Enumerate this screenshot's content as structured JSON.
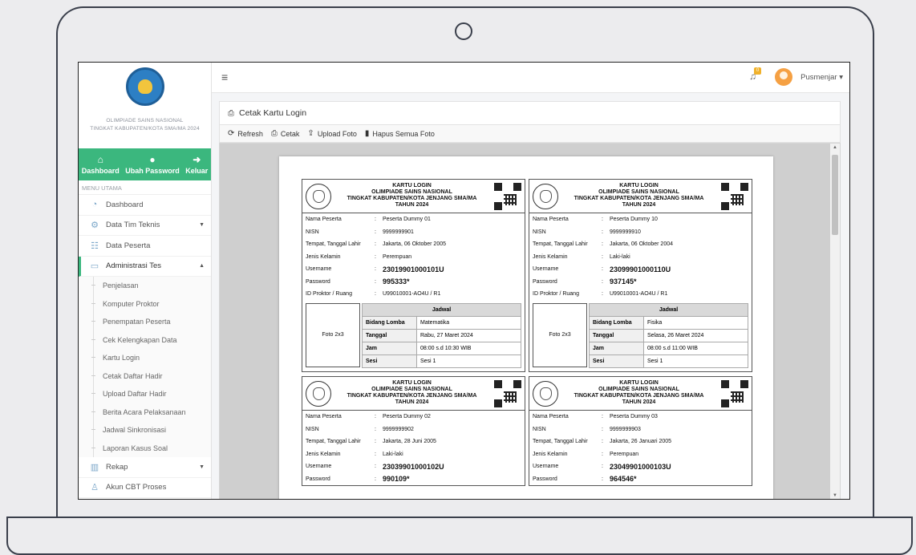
{
  "sidebar": {
    "logo_text_1": "OLIMPIADE SAINS NASIONAL",
    "logo_text_2": "TINGKAT KABUPATEN/KOTA SMA/MA 2024",
    "quick": [
      {
        "label": "Dashboard",
        "icon": "home-icon"
      },
      {
        "label": "Ubah Password",
        "icon": "user-key-icon"
      },
      {
        "label": "Keluar",
        "icon": "logout-icon"
      }
    ],
    "menu_title": "MENU UTAMA",
    "menu": [
      {
        "label": "Dashboard",
        "icon": "dashboard-icon"
      },
      {
        "label": "Data Tim Teknis",
        "icon": "team-icon"
      },
      {
        "label": "Data Peserta",
        "icon": "participants-icon"
      },
      {
        "label": "Administrasi Tes",
        "icon": "monitor-icon"
      }
    ],
    "submenu": [
      "Penjelasan",
      "Komputer Proktor",
      "Penempatan Peserta",
      "Cek Kelengkapan Data",
      "Kartu Login",
      "Cetak Daftar Hadir",
      "Upload Daftar Hadir",
      "Berita Acara Pelaksanaan",
      "Jadwal Sinkronisasi",
      "Laporan Kasus Soal"
    ],
    "menu_after": [
      {
        "label": "Rekap",
        "icon": "chart-icon"
      },
      {
        "label": "Akun CBT Proses",
        "icon": "account-icon"
      }
    ]
  },
  "topbar": {
    "notification_count": "0",
    "user_name": "Pusmenjar"
  },
  "panel": {
    "title": "Cetak Kartu Login",
    "toolbar": {
      "refresh": "Refresh",
      "print": "Cetak",
      "upload": "Upload Foto",
      "delete_all": "Hapus Semua Foto"
    }
  },
  "card_labels": {
    "title_1": "KARTU LOGIN",
    "title_2": "OLIMPIADE SAINS NASIONAL",
    "title_3": "TINGKAT KABUPATEN/KOTA JENJANG SMA/MA",
    "title_4": "TAHUN 2024",
    "nama": "Nama Peserta",
    "nisn": "NISN",
    "ttl": "Tempat, Tanggal Lahir",
    "jk": "Jenis Kelamin",
    "username": "Username",
    "password": "Password",
    "proktor": "ID Proktor / Ruang",
    "sep": ":",
    "foto": "Foto 2x3",
    "jadwal": "Jadwal",
    "bidang": "Bidang Lomba",
    "tanggal": "Tanggal",
    "jam": "Jam",
    "sesi": "Sesi"
  },
  "cards": [
    {
      "nama": "Peserta Dummy 01",
      "nisn": "9999999901",
      "ttl": "Jakarta, 06 Oktober 2005",
      "jk": "Perempuan",
      "username": "23019901000101U",
      "password": "995333*",
      "proktor": "U99010001-AO4U / R1",
      "bidang": "Matematika",
      "tanggal": "Rabu, 27 Maret 2024",
      "jam": "08:00 s.d 10:30 WIB",
      "sesi": "Sesi 1"
    },
    {
      "nama": "Peserta Dummy 10",
      "nisn": "9999999910",
      "ttl": "Jakarta, 06 Oktober 2004",
      "jk": "Laki-laki",
      "username": "23099901000110U",
      "password": "937145*",
      "proktor": "U99010001-AO4U / R1",
      "bidang": "Fisika",
      "tanggal": "Selasa, 26 Maret 2024",
      "jam": "08:00 s.d 11:00 WIB",
      "sesi": "Sesi 1"
    },
    {
      "nama": "Peserta Dummy 02",
      "nisn": "9999999902",
      "ttl": "Jakarta, 28 Juni 2005",
      "jk": "Laki-laki",
      "username": "23039901000102U",
      "password": "990109*"
    },
    {
      "nama": "Peserta Dummy 03",
      "nisn": "9999999903",
      "ttl": "Jakarta, 26 Januari 2005",
      "jk": "Perempuan",
      "username": "23049901000103U",
      "password": "964546*"
    }
  ]
}
